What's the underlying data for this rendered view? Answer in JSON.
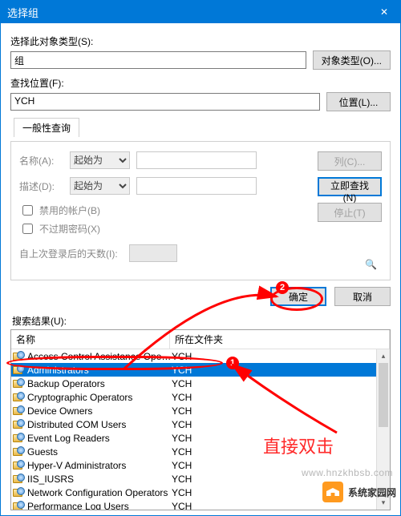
{
  "title": "选择组",
  "section_object_type_label": "选择此对象类型(S):",
  "object_type_value": "组",
  "btn_object_types": "对象类型(O)...",
  "section_location_label": "查找位置(F):",
  "location_value": "YCH",
  "btn_location": "位置(L)...",
  "tab_common": "一般性查询",
  "field_name_label": "名称(A):",
  "field_desc_label": "描述(D):",
  "combo_startswith": "起始为",
  "chk_disabled_accounts": "禁用的帐户(B)",
  "chk_nonexpire_pw": "不过期密码(X)",
  "days_since_label": "自上次登录后的天数(I):",
  "btn_columns": "列(C)...",
  "btn_findnow": "立即查找(N)",
  "btn_stop": "停止(T)",
  "btn_ok": "确定",
  "btn_cancel": "取消",
  "results_label": "搜索结果(U):",
  "col_name": "名称",
  "col_folder": "所在文件夹",
  "rows": [
    {
      "name": "Access Control Assistance Operat...",
      "folder": "YCH"
    },
    {
      "name": "Administrators",
      "folder": "YCH"
    },
    {
      "name": "Backup Operators",
      "folder": "YCH"
    },
    {
      "name": "Cryptographic Operators",
      "folder": "YCH"
    },
    {
      "name": "Device Owners",
      "folder": "YCH"
    },
    {
      "name": "Distributed COM Users",
      "folder": "YCH"
    },
    {
      "name": "Event Log Readers",
      "folder": "YCH"
    },
    {
      "name": "Guests",
      "folder": "YCH"
    },
    {
      "name": "Hyper-V Administrators",
      "folder": "YCH"
    },
    {
      "name": "IIS_IUSRS",
      "folder": "YCH"
    },
    {
      "name": "Network Configuration Operators",
      "folder": "YCH"
    },
    {
      "name": "Performance Log Users",
      "folder": "YCH"
    }
  ],
  "selected_row_index": 1,
  "annotation_badge1": "1",
  "annotation_badge2": "2",
  "annotation_text": "直接双击",
  "watermark_text": "系统家园网",
  "watermark_url": "www.hnzkhbsb.com"
}
